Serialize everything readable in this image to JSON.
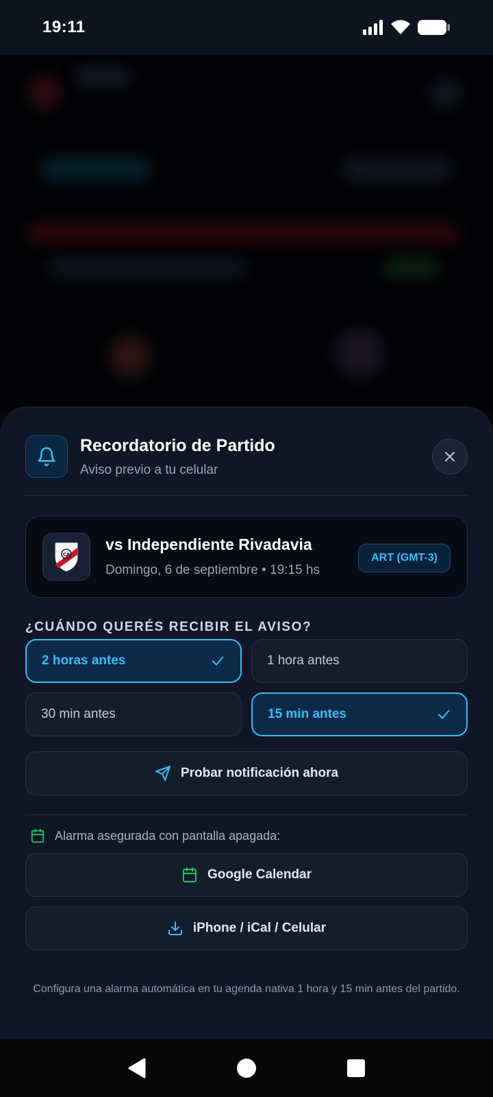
{
  "status_bar": {
    "time": "19:11"
  },
  "sheet": {
    "title": "Recordatorio de Partido",
    "subtitle": "Aviso previo a tu celular",
    "icon": "bell-icon",
    "close_icon": "close-icon"
  },
  "match": {
    "opponent": "vs Independiente Rivadavia",
    "date": "Domingo, 6 de septiembre • 19:15 hs",
    "timezone": "ART (GMT-3)",
    "crest": "river-plate-crest"
  },
  "reminder": {
    "section_label": "¿CUÁNDO QUERÉS RECIBIR EL AVISO?",
    "options": [
      {
        "label": "2 horas antes",
        "selected": true
      },
      {
        "label": "1 hora antes",
        "selected": false
      },
      {
        "label": "30 min antes",
        "selected": false
      },
      {
        "label": "15 min antes",
        "selected": true
      }
    ],
    "test_button": "Probar notificación ahora"
  },
  "calendar": {
    "alarm_note": "Alarma asegurada con pantalla apagada:",
    "google_button": "Google Calendar",
    "ical_button": "iPhone / iCal / Celular",
    "footnote": "Configura una alarma automática en tu agenda nativa 1 hora y 15 min antes del partido."
  },
  "colors": {
    "accent": "#38bdf8",
    "calendar_green": "#22c55e",
    "sheet_bg": "#0f1726"
  }
}
